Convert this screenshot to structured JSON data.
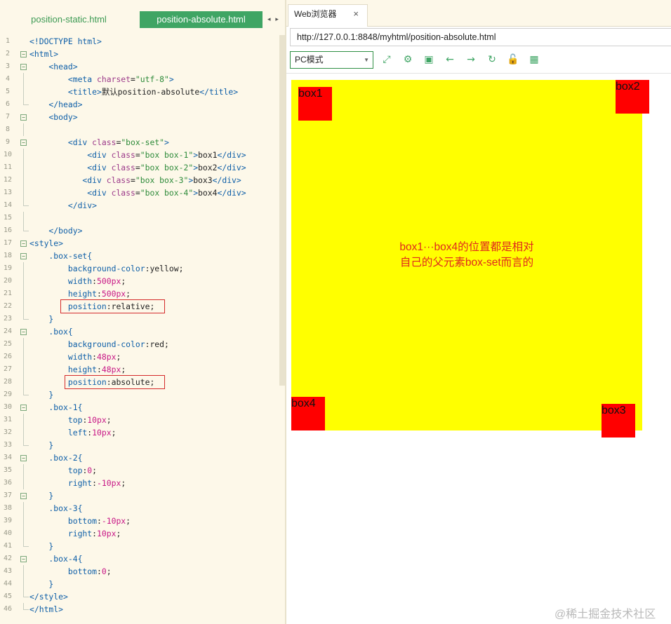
{
  "editor": {
    "tabs": [
      "position-static.html",
      "position-absolute.html"
    ],
    "tab_arrows": "◂ ▸",
    "code_lines": [
      [
        {
          "t": "<!DOCTYPE html>",
          "c": "t"
        }
      ],
      [
        {
          "t": "<html>",
          "c": "t"
        }
      ],
      [
        {
          "t": "    <head>",
          "c": "t"
        }
      ],
      [
        {
          "t": "        <meta ",
          "c": "t"
        },
        {
          "t": "charset",
          "c": "a"
        },
        {
          "t": "=",
          "c": "x"
        },
        {
          "t": "\"utf-8\"",
          "c": "s"
        },
        {
          "t": ">",
          "c": "t"
        }
      ],
      [
        {
          "t": "        <title>",
          "c": "t"
        },
        {
          "t": "默认position-absolute",
          "c": "x"
        },
        {
          "t": "</title>",
          "c": "t"
        }
      ],
      [
        {
          "t": "    </head>",
          "c": "t"
        }
      ],
      [
        {
          "t": "    <body>",
          "c": "t"
        }
      ],
      [],
      [
        {
          "t": "        <div ",
          "c": "t"
        },
        {
          "t": "class",
          "c": "a"
        },
        {
          "t": "=",
          "c": "x"
        },
        {
          "t": "\"box-set\"",
          "c": "s"
        },
        {
          "t": ">",
          "c": "t"
        }
      ],
      [
        {
          "t": "            <div ",
          "c": "t"
        },
        {
          "t": "class",
          "c": "a"
        },
        {
          "t": "=",
          "c": "x"
        },
        {
          "t": "\"box box-1\"",
          "c": "s"
        },
        {
          "t": ">",
          "c": "t"
        },
        {
          "t": "box1",
          "c": "x"
        },
        {
          "t": "</div>",
          "c": "t"
        }
      ],
      [
        {
          "t": "            <div ",
          "c": "t"
        },
        {
          "t": "class",
          "c": "a"
        },
        {
          "t": "=",
          "c": "x"
        },
        {
          "t": "\"box box-2\"",
          "c": "s"
        },
        {
          "t": ">",
          "c": "t"
        },
        {
          "t": "box2",
          "c": "x"
        },
        {
          "t": "</div>",
          "c": "t"
        }
      ],
      [
        {
          "t": "           <div ",
          "c": "t"
        },
        {
          "t": "class",
          "c": "a"
        },
        {
          "t": "=",
          "c": "x"
        },
        {
          "t": "\"box box-3\"",
          "c": "s"
        },
        {
          "t": ">",
          "c": "t"
        },
        {
          "t": "box3",
          "c": "x"
        },
        {
          "t": "</div>",
          "c": "t"
        }
      ],
      [
        {
          "t": "            <div ",
          "c": "t"
        },
        {
          "t": "class",
          "c": "a"
        },
        {
          "t": "=",
          "c": "x"
        },
        {
          "t": "\"box box-4\"",
          "c": "s"
        },
        {
          "t": ">",
          "c": "t"
        },
        {
          "t": "box4",
          "c": "x"
        },
        {
          "t": "</div>",
          "c": "t"
        }
      ],
      [
        {
          "t": "        </div>",
          "c": "t"
        }
      ],
      [],
      [
        {
          "t": "    </body>",
          "c": "t"
        }
      ],
      [
        {
          "t": "<style>",
          "c": "t"
        }
      ],
      [
        {
          "t": "    .box-set{",
          "c": "p"
        }
      ],
      [
        {
          "t": "        background-color",
          "c": "p"
        },
        {
          "t": ":yellow;",
          "c": "v"
        }
      ],
      [
        {
          "t": "        width",
          "c": "p"
        },
        {
          "t": ":",
          "c": "v"
        },
        {
          "t": "500",
          "c": "n"
        },
        {
          "t": "px",
          "c": "n"
        },
        {
          "t": ";",
          "c": "v"
        }
      ],
      [
        {
          "t": "        height",
          "c": "p"
        },
        {
          "t": ":",
          "c": "v"
        },
        {
          "t": "500",
          "c": "n"
        },
        {
          "t": "px",
          "c": "n"
        },
        {
          "t": ";",
          "c": "v"
        }
      ],
      [
        {
          "t": "        position",
          "c": "p"
        },
        {
          "t": ":relative;",
          "c": "v"
        }
      ],
      [
        {
          "t": "    }",
          "c": "p"
        }
      ],
      [
        {
          "t": "    .box{",
          "c": "p"
        }
      ],
      [
        {
          "t": "        background-color",
          "c": "p"
        },
        {
          "t": ":red;",
          "c": "v"
        }
      ],
      [
        {
          "t": "        width",
          "c": "p"
        },
        {
          "t": ":",
          "c": "v"
        },
        {
          "t": "48",
          "c": "n"
        },
        {
          "t": "px",
          "c": "n"
        },
        {
          "t": ";",
          "c": "v"
        }
      ],
      [
        {
          "t": "        height",
          "c": "p"
        },
        {
          "t": ":",
          "c": "v"
        },
        {
          "t": "48",
          "c": "n"
        },
        {
          "t": "px",
          "c": "n"
        },
        {
          "t": ";",
          "c": "v"
        }
      ],
      [
        {
          "t": "        position",
          "c": "p"
        },
        {
          "t": ":absolute;",
          "c": "v"
        }
      ],
      [
        {
          "t": "    }",
          "c": "p"
        }
      ],
      [
        {
          "t": "    .box-1{",
          "c": "p"
        }
      ],
      [
        {
          "t": "        top",
          "c": "p"
        },
        {
          "t": ":",
          "c": "v"
        },
        {
          "t": "10",
          "c": "n"
        },
        {
          "t": "px",
          "c": "n"
        },
        {
          "t": ";",
          "c": "v"
        }
      ],
      [
        {
          "t": "        left",
          "c": "p"
        },
        {
          "t": ":",
          "c": "v"
        },
        {
          "t": "10",
          "c": "n"
        },
        {
          "t": "px",
          "c": "n"
        },
        {
          "t": ";",
          "c": "v"
        }
      ],
      [
        {
          "t": "    }",
          "c": "p"
        }
      ],
      [
        {
          "t": "    .box-2{",
          "c": "p"
        }
      ],
      [
        {
          "t": "        top",
          "c": "p"
        },
        {
          "t": ":",
          "c": "v"
        },
        {
          "t": "0",
          "c": "n"
        },
        {
          "t": ";",
          "c": "v"
        }
      ],
      [
        {
          "t": "        right",
          "c": "p"
        },
        {
          "t": ":",
          "c": "v"
        },
        {
          "t": "-10",
          "c": "n"
        },
        {
          "t": "px",
          "c": "n"
        },
        {
          "t": ";",
          "c": "v"
        }
      ],
      [
        {
          "t": "    }",
          "c": "p"
        }
      ],
      [
        {
          "t": "    .box-3{",
          "c": "p"
        }
      ],
      [
        {
          "t": "        bottom",
          "c": "p"
        },
        {
          "t": ":",
          "c": "v"
        },
        {
          "t": "-10",
          "c": "n"
        },
        {
          "t": "px",
          "c": "n"
        },
        {
          "t": ";",
          "c": "v"
        }
      ],
      [
        {
          "t": "        right",
          "c": "p"
        },
        {
          "t": ":",
          "c": "v"
        },
        {
          "t": "10",
          "c": "n"
        },
        {
          "t": "px",
          "c": "n"
        },
        {
          "t": ";",
          "c": "v"
        }
      ],
      [
        {
          "t": "    }",
          "c": "p"
        }
      ],
      [
        {
          "t": "    .box-4{",
          "c": "p"
        }
      ],
      [
        {
          "t": "        bottom",
          "c": "p"
        },
        {
          "t": ":",
          "c": "v"
        },
        {
          "t": "0",
          "c": "n"
        },
        {
          "t": ";",
          "c": "v"
        }
      ],
      [
        {
          "t": "    }",
          "c": "p"
        }
      ],
      [
        {
          "t": "</style>",
          "c": "t"
        }
      ],
      [
        {
          "t": "</html>",
          "c": "t"
        }
      ]
    ],
    "fold_lines": [
      2,
      3,
      7,
      9,
      17,
      18,
      24,
      30,
      34,
      37,
      42
    ],
    "fold_glyph": "−",
    "highlight_lines": [
      22,
      28
    ]
  },
  "browser": {
    "tab_label": "Web浏览器",
    "tab_close": "×",
    "url": "http://127.0.0.1:8848/myhtml/position-absolute.html",
    "mode_select": "PC模式",
    "mode_arrow": "▼",
    "toolbar_icons": [
      {
        "name": "resize-icon",
        "glyph": "⤢"
      },
      {
        "name": "settings-icon",
        "glyph": "⚙"
      },
      {
        "name": "console-icon",
        "glyph": "▣"
      },
      {
        "name": "back-arrow-icon",
        "glyph": "←"
      },
      {
        "name": "forward-arrow-icon",
        "glyph": "→"
      },
      {
        "name": "refresh-icon",
        "glyph": "↻"
      },
      {
        "name": "lock-icon",
        "glyph": "🔓"
      },
      {
        "name": "qr-grid-icon",
        "glyph": "▦"
      }
    ],
    "page": {
      "box1": "box1",
      "box2": "box2",
      "box3": "box3",
      "box4": "box4",
      "note_line1": "box1···box4的位置都是相对",
      "note_line2": "自己的父元素box-set而言的"
    }
  },
  "watermark": "@稀土掘金技术社区",
  "colors": {
    "editor_bg": "#fdf8e9",
    "tab_active": "#3fa564",
    "box_set": "#ffff00",
    "box": "#ff0000",
    "note": "#e0291d",
    "highlight_border": "#d42a2a"
  }
}
